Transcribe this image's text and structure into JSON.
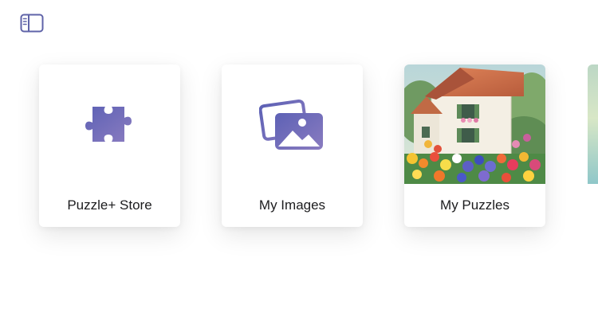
{
  "toolbar": {
    "sidebar_icon": "sidebar-left-icon",
    "accent_color": "#6C6DAE"
  },
  "cards": [
    {
      "label": "Puzzle+ Store",
      "icon": "puzzle-piece-icon"
    },
    {
      "label": "My Images",
      "icon": "photos-icon"
    },
    {
      "label": "My Puzzles",
      "icon": "painting-thumbnail"
    }
  ],
  "colors": {
    "icon_gradient_top": "#5d61b5",
    "icon_gradient_bottom": "#8a7cc0"
  }
}
